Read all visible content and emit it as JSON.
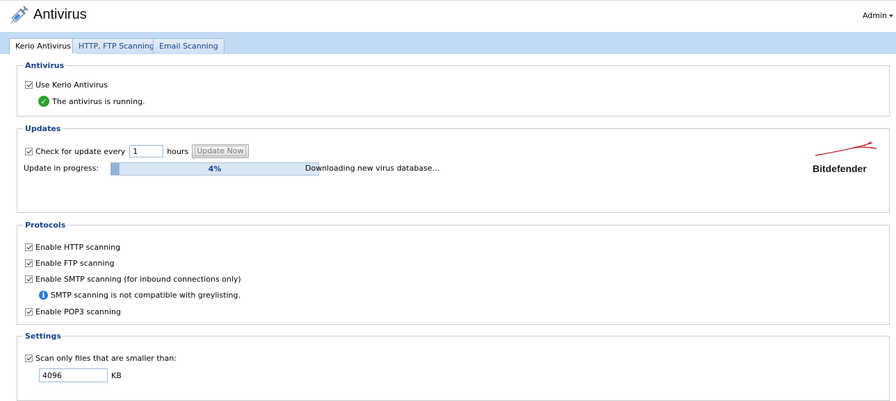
{
  "header": {
    "title": "Antivirus",
    "user": "Admin",
    "app_icon": "syringe-icon"
  },
  "tabs": [
    {
      "label": "Kerio Antivirus",
      "active": true
    },
    {
      "label": "HTTP, FTP Scanning",
      "active": false
    },
    {
      "label": "Email Scanning",
      "active": false
    }
  ],
  "antivirus": {
    "legend": "Antivirus",
    "use_label": "Use Kerio Antivirus",
    "use_checked": true,
    "status_text": "The antivirus is running."
  },
  "updates": {
    "legend": "Updates",
    "check_label": "Check for update every",
    "check_checked": true,
    "interval_value": "1",
    "interval_unit": "hours",
    "update_now_label": "Update Now",
    "progress_label": "Update in progress:",
    "progress_percent": 4,
    "progress_text": "4%",
    "status_text": "Downloading new virus database...",
    "brand": "Bitdefender",
    "brand_color": "#c1272d"
  },
  "protocols": {
    "legend": "Protocols",
    "items": [
      {
        "label": "Enable HTTP scanning",
        "checked": true
      },
      {
        "label": "Enable FTP scanning",
        "checked": true
      },
      {
        "label": "Enable SMTP scanning (for inbound connections only)",
        "checked": true
      },
      {
        "label": "Enable POP3 scanning",
        "checked": true
      }
    ],
    "smtp_note": "SMTP scanning is not compatible with greylisting."
  },
  "settings": {
    "legend": "Settings",
    "scan_label": "Scan only files that are smaller than:",
    "scan_checked": true,
    "size_value": "4096",
    "size_unit": "KB"
  },
  "colors": {
    "tab_strip": "#c2dbf3",
    "legend_text": "#15428b",
    "ok_icon": "#2aa12f",
    "info_icon": "#2a78d6"
  }
}
